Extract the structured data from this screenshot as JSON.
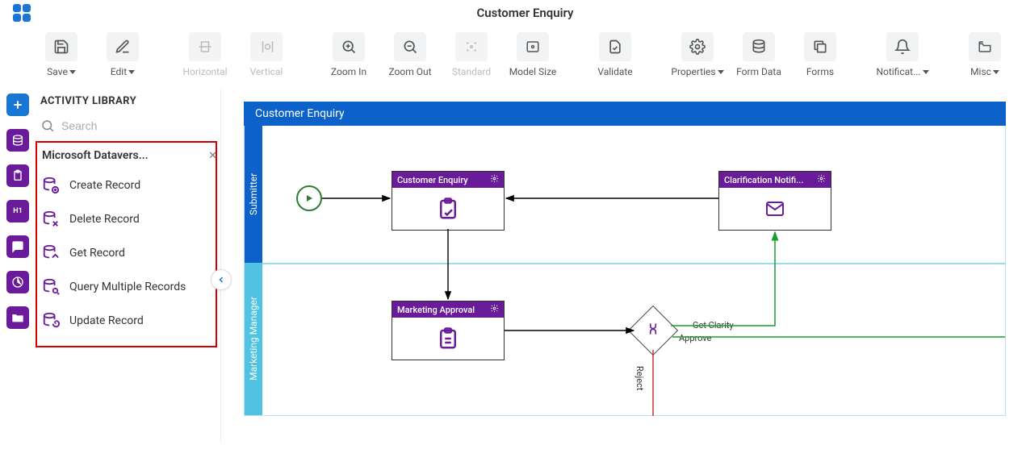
{
  "header": {
    "title": "Customer Enquiry"
  },
  "toolbar": {
    "save": "Save",
    "edit": "Edit",
    "horizontal": "Horizontal",
    "vertical": "Vertical",
    "zoom_in": "Zoom In",
    "zoom_out": "Zoom Out",
    "standard": "Standard",
    "model_size": "Model Size",
    "validate": "Validate",
    "properties": "Properties",
    "form_data": "Form Data",
    "forms": "Forms",
    "notifications": "Notificat...",
    "misc": "Misc"
  },
  "library": {
    "heading": "ACTIVITY LIBRARY",
    "search_placeholder": "Search",
    "category": "Microsoft Datavers...",
    "items": [
      {
        "label": "Create Record"
      },
      {
        "label": "Delete Record"
      },
      {
        "label": "Get Record"
      },
      {
        "label": "Query Multiple Records"
      },
      {
        "label": "Update Record"
      }
    ]
  },
  "process": {
    "title": "Customer Enquiry",
    "lanes": {
      "submitter": "Submitter",
      "manager": "Marketing Manager"
    },
    "tasks": {
      "customer_enquiry": "Customer Enquiry",
      "clarification": "Clarification Notifi...",
      "marketing_approval": "Marketing Approval"
    },
    "edges": {
      "get_clarity": "Get Clarity",
      "approve": "Approve",
      "reject": "Reject"
    }
  }
}
